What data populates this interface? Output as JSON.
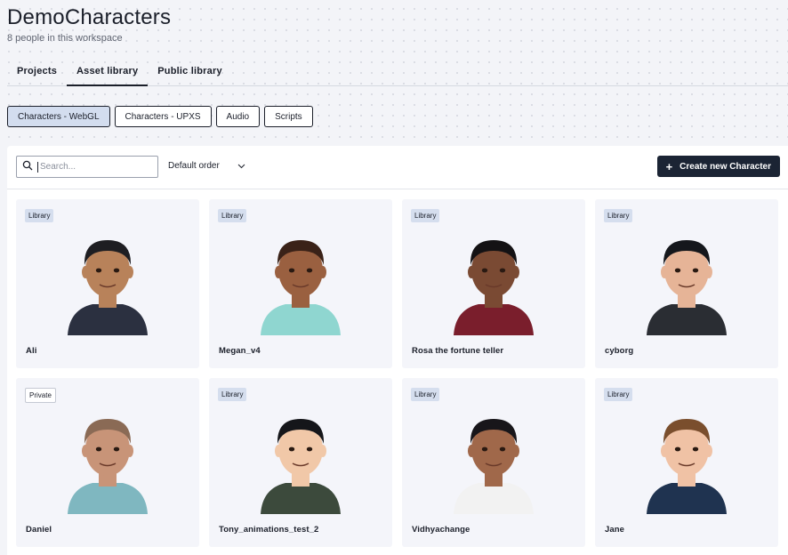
{
  "workspace": {
    "title": "DemoCharacters",
    "subtitle": "8 people in this workspace"
  },
  "tabs": [
    {
      "label": "Projects",
      "active": false
    },
    {
      "label": "Asset library",
      "active": true
    },
    {
      "label": "Public library",
      "active": false
    }
  ],
  "filters": [
    {
      "label": "Characters - WebGL",
      "active": true
    },
    {
      "label": "Characters - UPXS",
      "active": false
    },
    {
      "label": "Audio",
      "active": false
    },
    {
      "label": "Scripts",
      "active": false
    }
  ],
  "toolbar": {
    "search_placeholder": "Search...",
    "sort_label": "Default order",
    "create_label": "Create new Character",
    "create_icon": "plus-icon"
  },
  "colors": {
    "accent_dark": "#1b2434",
    "chip_active": "#d3ddef",
    "badge_library": "#d5deee"
  },
  "characters": [
    {
      "name": "Ali",
      "badge": "Library",
      "skin": "#b8825a",
      "hair": "#1e1e22",
      "shirt": "#2b3040",
      "bg": "#e9ebf2"
    },
    {
      "name": "Megan_v4",
      "badge": "Library",
      "skin": "#9a6040",
      "hair": "#3a2218",
      "shirt": "#8fd6d0",
      "bg": "#e9ebf2"
    },
    {
      "name": "Rosa the fortune teller",
      "badge": "Library",
      "skin": "#7a4a33",
      "hair": "#141214",
      "shirt": "#7a1e2c",
      "bg": "#e9ebf2"
    },
    {
      "name": "cyborg",
      "badge": "Library",
      "skin": "#e6b497",
      "hair": "#15171c",
      "shirt": "#2a2d33",
      "bg": "#e9ebf2"
    },
    {
      "name": "Daniel",
      "badge": "Private",
      "skin": "#c89478",
      "hair": "#8a6a55",
      "shirt": "#7fb7c0",
      "bg": "#e9ebf2"
    },
    {
      "name": "Tony_animations_test_2",
      "badge": "Library",
      "skin": "#f1c8a8",
      "hair": "#15161a",
      "shirt": "#3c4a3c",
      "bg": "#e9ebf2"
    },
    {
      "name": "Vidhyachange",
      "badge": "Library",
      "skin": "#a0684a",
      "hair": "#18161a",
      "shirt": "#f2f2f2",
      "bg": "#e9ebf2"
    },
    {
      "name": "Jane",
      "badge": "Library",
      "skin": "#f0c2a5",
      "hair": "#7a4e2d",
      "shirt": "#1f3350",
      "bg": "#e9ebf2"
    }
  ]
}
